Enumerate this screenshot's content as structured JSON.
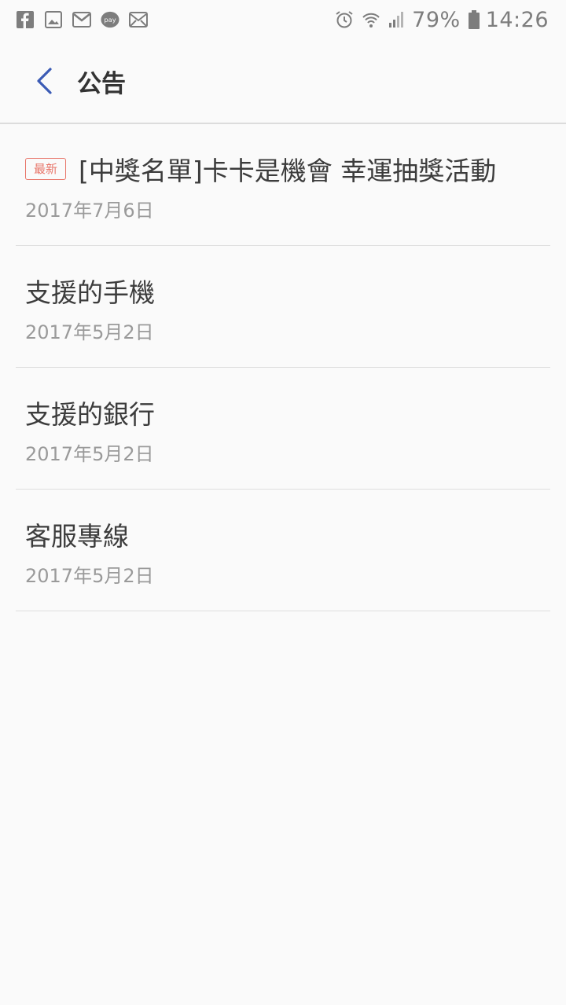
{
  "status_bar": {
    "left_icons": [
      "facebook-icon",
      "gallery-icon",
      "gmail-icon",
      "pay-icon",
      "email-icon"
    ],
    "pay_label": "pay",
    "battery_percent": "79%",
    "time": "14:26",
    "right_icons": [
      "alarm-icon",
      "wifi-icon",
      "signal-icon",
      "battery-icon"
    ]
  },
  "header": {
    "title": "公告",
    "back_icon": "chevron-left-icon",
    "accent_color": "#3b5bb5"
  },
  "announcements": [
    {
      "badge": "最新",
      "title": "[中獎名單]卡卡是機會 幸運抽獎活動",
      "date": "2017年7月6日"
    },
    {
      "badge": "",
      "title": "支援的手機",
      "date": "2017年5月2日"
    },
    {
      "badge": "",
      "title": "支援的銀行",
      "date": "2017年5月2日"
    },
    {
      "badge": "",
      "title": "客服專線",
      "date": "2017年5月2日"
    }
  ],
  "colors": {
    "badge": "#e8766a",
    "background": "#fafafa",
    "title_text": "#3c3c3c",
    "date_text": "#9a9a9a"
  }
}
